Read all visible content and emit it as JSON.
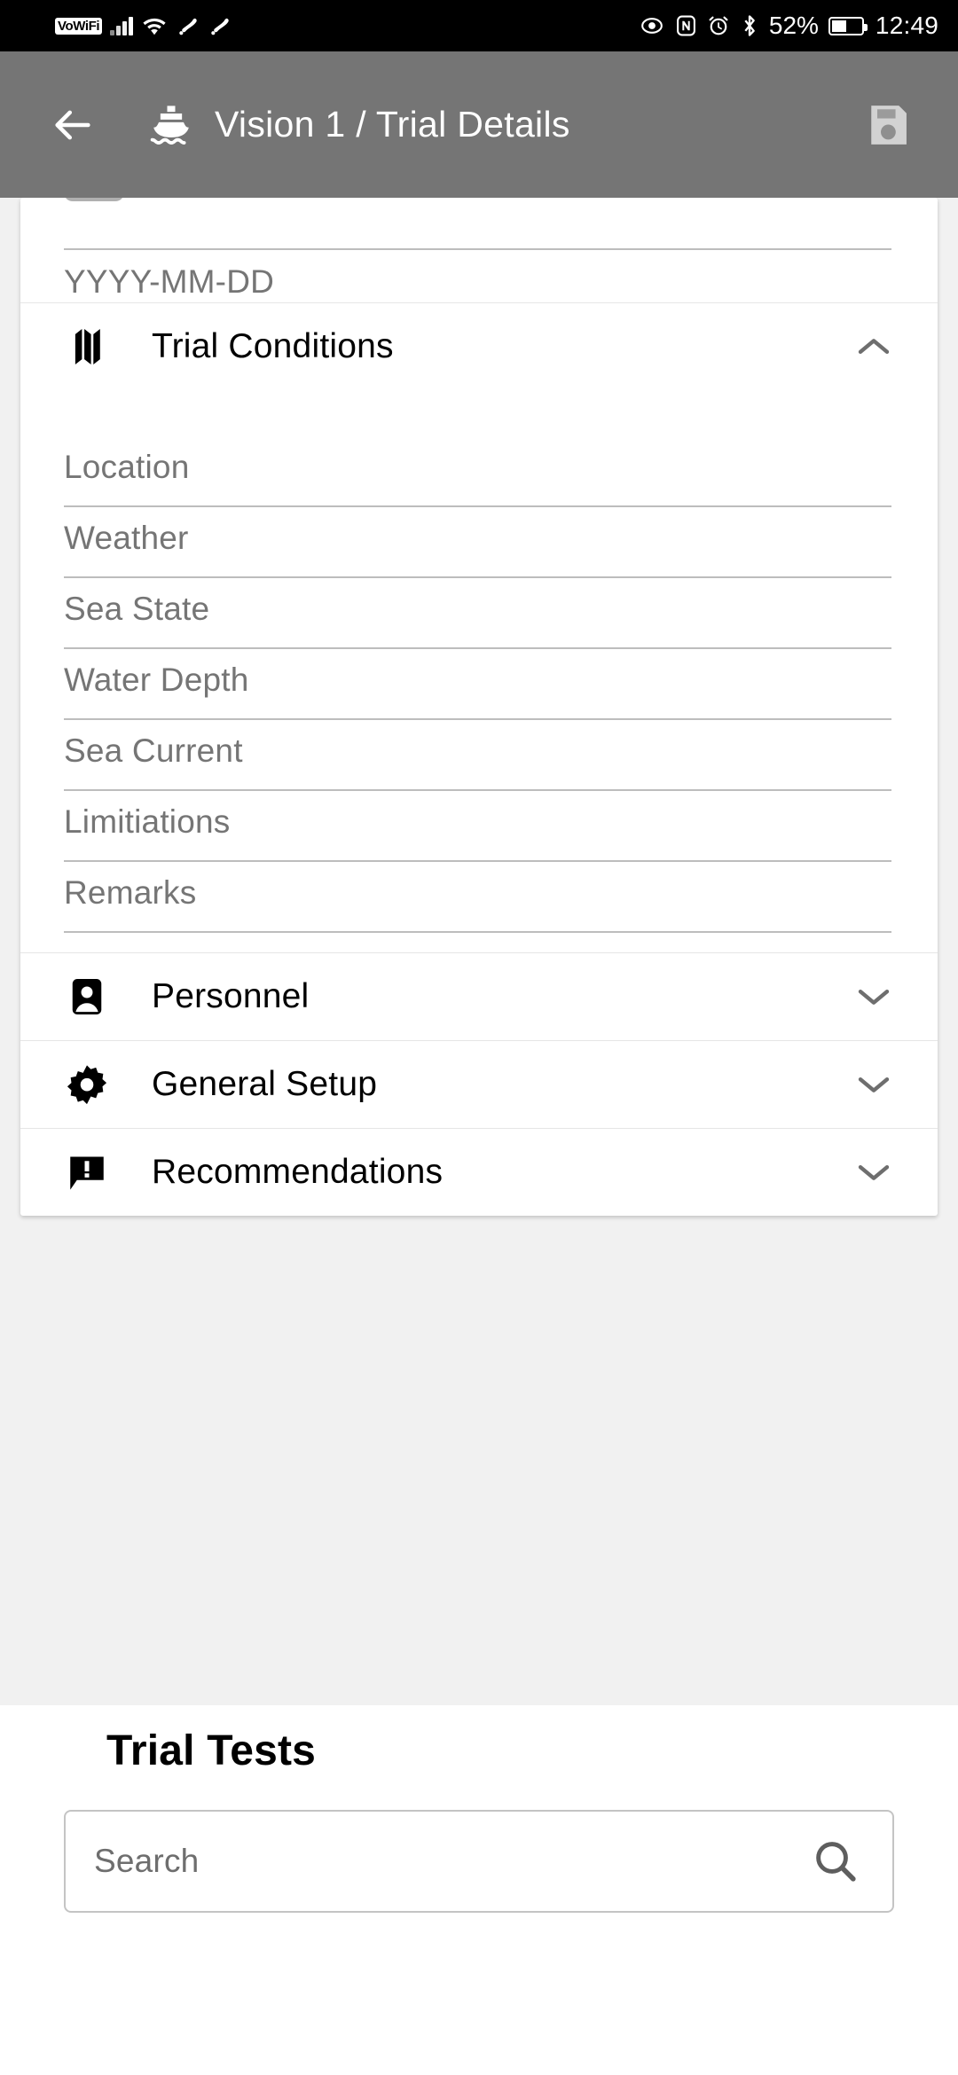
{
  "status_bar": {
    "vowifi_badge": "VoWiFi",
    "battery_percent": "52%",
    "time": "12:49",
    "icons": [
      "signal-bars-icon",
      "wifi-icon",
      "step-counter-icon",
      "step-counter-icon",
      "eye-icon",
      "nfc-icon",
      "alarm-clock-icon",
      "bluetooth-icon",
      "battery-icon"
    ]
  },
  "app_bar": {
    "back_icon": "back-arrow-icon",
    "vessel_icon": "ship-icon",
    "breadcrumb_parent": "Vision 1",
    "breadcrumb_separator": "/",
    "breadcrumb_current": "Trial Details",
    "title": "Vision 1  /  Trial Details",
    "save_icon": "save-floppy-icon",
    "background_color": "#757575"
  },
  "form": {
    "date_field": {
      "placeholder": "YYYY-MM-DD",
      "value": ""
    }
  },
  "sections": [
    {
      "id": "trial-conditions",
      "label": "Trial Conditions",
      "icon": "map-icon",
      "expanded": true,
      "chevron": "chevron-up-icon",
      "fields": [
        {
          "id": "location",
          "placeholder": "Location",
          "value": ""
        },
        {
          "id": "weather",
          "placeholder": "Weather",
          "value": ""
        },
        {
          "id": "sea-state",
          "placeholder": "Sea State",
          "value": ""
        },
        {
          "id": "water-depth",
          "placeholder": "Water Depth",
          "value": ""
        },
        {
          "id": "sea-current",
          "placeholder": "Sea Current",
          "value": ""
        },
        {
          "id": "limitiations",
          "placeholder": "Limitiations",
          "value": ""
        },
        {
          "id": "remarks",
          "placeholder": "Remarks",
          "value": ""
        }
      ]
    },
    {
      "id": "personnel",
      "label": "Personnel",
      "icon": "contact-badge-icon",
      "expanded": false,
      "chevron": "chevron-down-icon"
    },
    {
      "id": "general-setup",
      "label": "General Setup",
      "icon": "gear-icon",
      "expanded": false,
      "chevron": "chevron-down-icon"
    },
    {
      "id": "recommendations",
      "label": "Recommendations",
      "icon": "comment-alert-icon",
      "expanded": false,
      "chevron": "chevron-down-icon"
    }
  ],
  "trial_tests": {
    "title": "Trial Tests",
    "search_placeholder": "Search",
    "search_value": "",
    "search_icon": "search-icon"
  },
  "colors": {
    "app_bar": "#757575",
    "status_bar": "#000000",
    "page_background": "#f1f1f1",
    "card": "#ffffff",
    "placeholder_text": "#757575",
    "rule": "#bdbdbd",
    "chevron": "#6e6e6e"
  }
}
